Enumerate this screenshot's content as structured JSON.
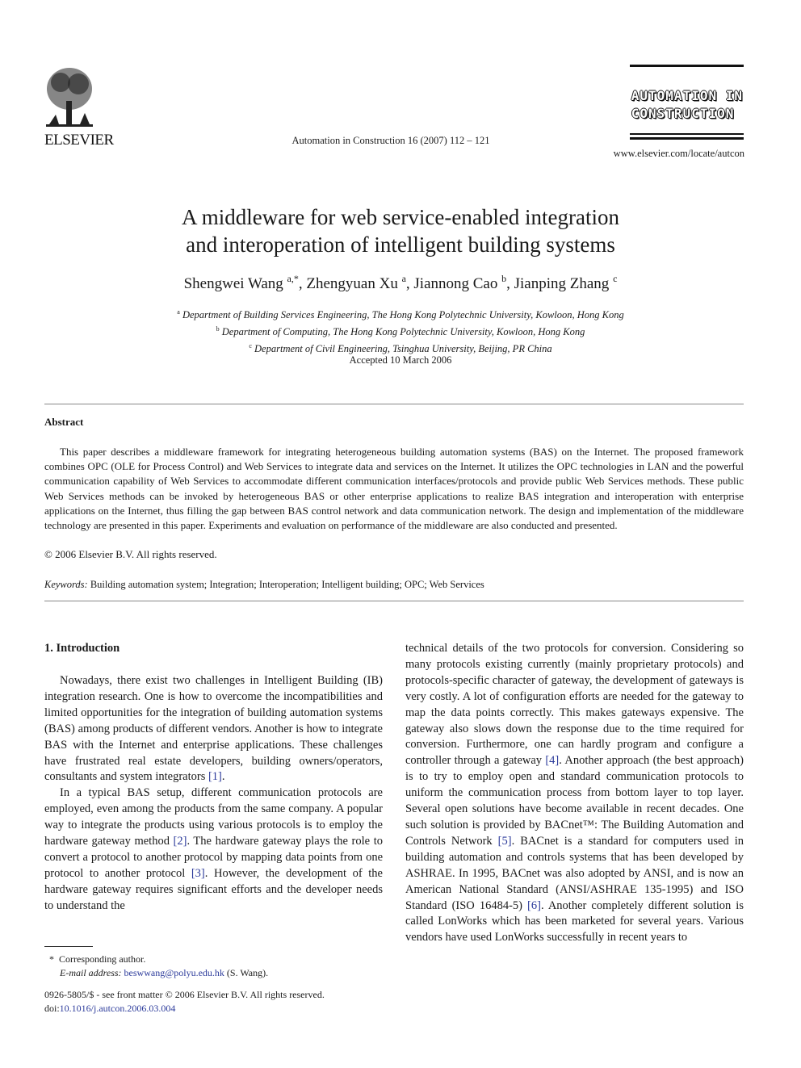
{
  "header": {
    "publisher": "ELSEVIER",
    "logo_icon": "elsevier-tree-icon",
    "journal_ref": "Automation in Construction 16 (2007) 112 – 121",
    "journal_brand_line1": "AUTOMATION IN",
    "journal_brand_line2": "CONSTRUCTION",
    "site_url": "www.elsevier.com/locate/autcon"
  },
  "article": {
    "title_line1": "A middleware for web service-enabled integration",
    "title_line2": "and interoperation of intelligent building systems",
    "authors": [
      {
        "name": "Shengwei Wang",
        "sup": "a,*"
      },
      {
        "name": "Zhengyuan Xu",
        "sup": "a"
      },
      {
        "name": "Jiannong Cao",
        "sup": "b"
      },
      {
        "name": "Jianping Zhang",
        "sup": "c"
      }
    ],
    "affiliations": [
      {
        "sup": "a",
        "text": "Department of Building Services Engineering, The Hong Kong Polytechnic University, Kowloon, Hong Kong"
      },
      {
        "sup": "b",
        "text": "Department of Computing, The Hong Kong Polytechnic University, Kowloon, Hong Kong"
      },
      {
        "sup": "c",
        "text": "Department of Civil Engineering, Tsinghua University, Beijing, PR China"
      }
    ],
    "accepted": "Accepted 10 March 2006"
  },
  "abstract": {
    "heading": "Abstract",
    "text": "This paper describes a middleware framework for integrating heterogeneous building automation systems (BAS) on the Internet. The proposed framework combines OPC (OLE for Process Control) and Web Services to integrate data and services on the Internet. It utilizes the OPC technologies in LAN and the powerful communication capability of Web Services to accommodate different communication interfaces/protocols and provide public Web Services methods. These public Web Services methods can be invoked by heterogeneous BAS or other enterprise applications to realize BAS integration and interoperation with enterprise applications on the Internet, thus filling the gap between BAS control network and data communication network. The design and implementation of the middleware technology are presented in this paper. Experiments and evaluation on performance of the middleware are also conducted and presented.",
    "copyright": "© 2006 Elsevier B.V. All rights reserved.",
    "keywords_label": "Keywords:",
    "keywords": "Building automation system; Integration; Interoperation; Intelligent building; OPC; Web Services"
  },
  "body": {
    "section_heading": "1. Introduction",
    "p1_a": "Nowadays, there exist two challenges in Intelligent Building (IB) integration research. One is how to overcome the incompatibilities and limited opportunities for the integration of building automation systems (BAS) among products of different vendors. Another is how to integrate BAS with the Internet and enterprise applications. These challenges have frustrated real estate developers, building owners/operators, consultants and system integrators ",
    "ref1": "[1]",
    "p1_b": ".",
    "p2_a": "In a typical BAS setup, different communication protocols are employed, even among the products from the same company. A popular way to integrate the products using various protocols is to employ the hardware gateway method ",
    "ref2": "[2]",
    "p2_b": ". The hardware gateway plays the role to convert a protocol to another protocol by mapping data points from one protocol to another protocol ",
    "ref3": "[3]",
    "p2_c": ". However, the development of the hardware gateway requires significant efforts and the developer needs to understand the",
    "r_a": "technical details of the two protocols for conversion. Considering so many protocols existing currently (mainly proprietary protocols) and protocols-specific character of gateway, the development of gateways is very costly. A lot of configuration efforts are needed for the gateway to map the data points correctly. This makes gateways expensive. The gateway also slows down the response due to the time required for conversion. Furthermore, one can hardly program and configure a controller through a gateway ",
    "ref4": "[4]",
    "r_b": ". Another approach (the best approach) is to try to employ open and standard communication protocols to uniform the communication process from bottom layer to top layer. Several open solutions have become available in recent decades. One such solution is provided by BACnet™: The Building Automation and Controls Network ",
    "ref5": "[5]",
    "r_c": ". BACnet is a standard for computers used in building automation and controls systems that has been developed by ASHRAE. In 1995, BACnet was also adopted by ANSI, and is now an American National Standard (ANSI/ASHRAE 135-1995) and ISO Standard (ISO 16484-5) ",
    "ref6": "[6]",
    "r_d": ". Another completely different solution is called LonWorks which has been marketed for several years. Various vendors have used LonWorks successfully in recent years to"
  },
  "footnote": {
    "marker": "*",
    "corresponding": "Corresponding author.",
    "email_label": "E-mail address:",
    "email": "beswwang@polyu.edu.hk",
    "email_owner": "(S. Wang)."
  },
  "issn": {
    "line": "0926-5805/$ - see front matter © 2006 Elsevier B.V. All rights reserved.",
    "doi_label": "doi:",
    "doi": "10.1016/j.autcon.2006.03.004"
  },
  "colors": {
    "link": "#2c3b9b",
    "text": "#1a1a1a"
  }
}
